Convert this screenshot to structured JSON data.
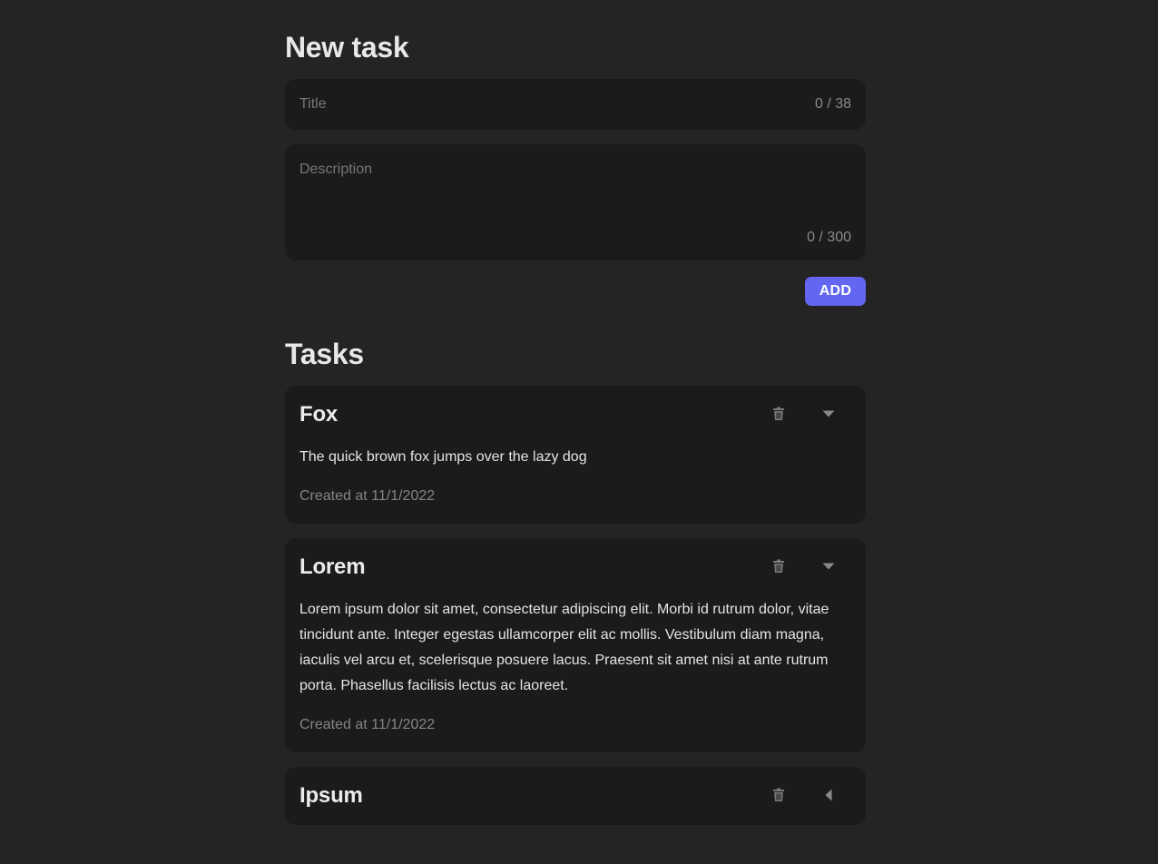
{
  "new_task": {
    "heading": "New task",
    "title_placeholder": "Title",
    "title_counter": "0 / 38",
    "description_placeholder": "Description",
    "description_counter": "0 / 300",
    "add_label": "ADD"
  },
  "tasks_section": {
    "heading": "Tasks",
    "items": [
      {
        "title": "Fox",
        "description": "The quick brown fox jumps over the lazy dog",
        "created": "Created at 11/1/2022",
        "expanded": true
      },
      {
        "title": "Lorem",
        "description": "Lorem ipsum dolor sit amet, consectetur adipiscing elit. Morbi id rutrum dolor, vitae tincidunt ante. Integer egestas ullamcorper elit ac mollis. Vestibulum diam magna, iaculis vel arcu et, scelerisque posuere lacus. Praesent sit amet nisi at ante rutrum porta. Phasellus facilisis lectus ac laoreet.",
        "created": "Created at 11/1/2022",
        "expanded": true
      },
      {
        "title": "Ipsum",
        "expanded": false
      }
    ]
  },
  "icons": {
    "delete": "trash-icon",
    "expanded": "caret-down-icon",
    "collapsed": "caret-left-icon"
  },
  "colors": {
    "background": "#242424",
    "card": "#1b1b1b",
    "accent": "#6366f1"
  }
}
